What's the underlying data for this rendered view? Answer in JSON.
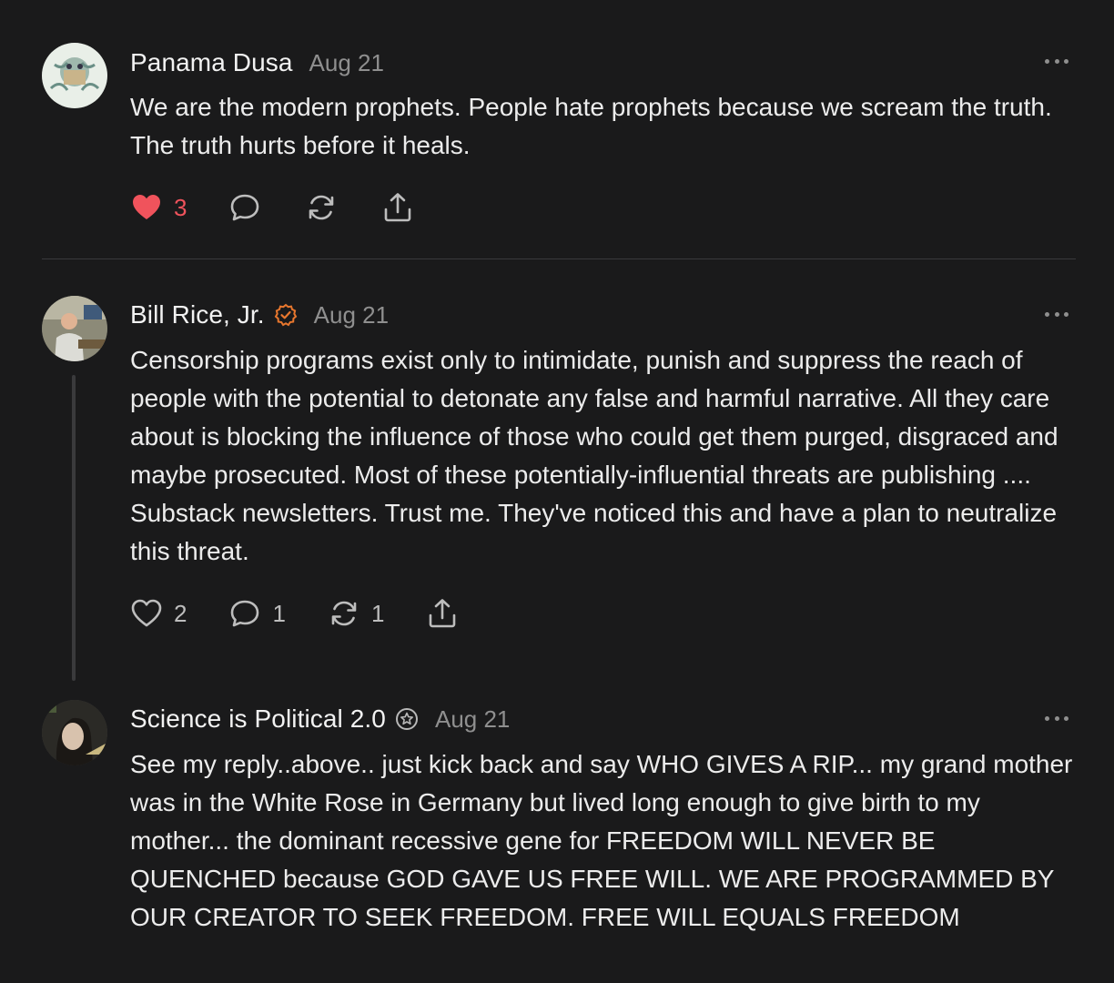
{
  "comments": [
    {
      "author": "Panama Dusa",
      "date": "Aug 21",
      "body": "We are the modern prophets. People hate prophets because we scream the truth. The truth hurts before it heals.",
      "actions": {
        "likes": "3",
        "liked": true,
        "replies": "",
        "restacks": ""
      }
    },
    {
      "author": "Bill Rice, Jr.",
      "badge": "checkmark-badge-icon",
      "date": "Aug 21",
      "body": "Censorship programs exist only to intimidate, punish and suppress the reach of people with the potential to detonate any false and harmful narrative. All they care about is blocking the influence of those who could get them purged, disgraced and maybe prosecuted. Most of these potentially-influential threats are publishing .... Substack newsletters. Trust me. They've noticed this and have a plan to neutralize this threat.",
      "actions": {
        "likes": "2",
        "liked": false,
        "replies": "1",
        "restacks": "1"
      }
    },
    {
      "author": "Science is Political 2.0",
      "badge": "star-badge-icon",
      "date": "Aug 21",
      "body": "See my reply..above.. just kick back and say WHO GIVES A RIP... my grand mother was in the White Rose in Germany but lived long enough to give birth to my mother... the dominant recessive gene for FREEDOM WILL NEVER BE QUENCHED because GOD GAVE US FREE WILL. WE ARE PROGRAMMED BY OUR CREATOR TO SEEK FREEDOM. FREE WILL EQUALS FREEDOM"
    }
  ],
  "colors": {
    "background": "#1a1a1b",
    "like_active": "#f0535c",
    "badge_orange": "#e8772e",
    "muted": "#8f8f8f"
  },
  "icons": [
    "heart-icon",
    "comment-icon",
    "restack-icon",
    "share-icon",
    "more-icon"
  ]
}
